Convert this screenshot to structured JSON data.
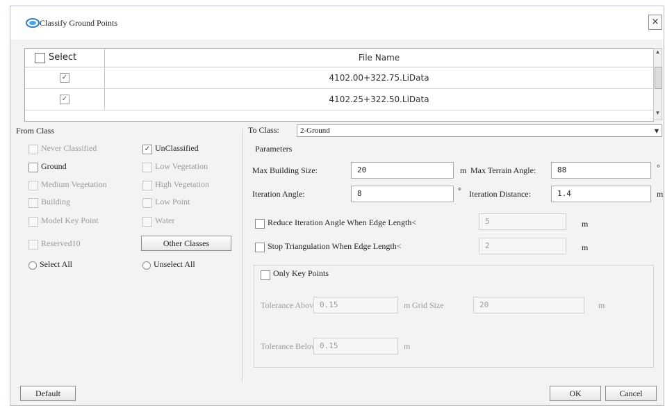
{
  "window": {
    "title": "Classify Ground Points",
    "close_glyph": "×"
  },
  "grid": {
    "select_header": "Select",
    "file_header": "File Name",
    "rows": [
      {
        "checked": "✓",
        "file": "4102.00+322.75.LiData"
      },
      {
        "checked": "✓",
        "file": "4102.25+322.50.LiData"
      }
    ]
  },
  "from_class": {
    "title": "From Class",
    "items": [
      {
        "label": "Never Classified",
        "checked": false,
        "enabled": false
      },
      {
        "label": "UnClassified",
        "checked": true,
        "enabled": true
      },
      {
        "label": "Ground",
        "checked": false,
        "enabled": true
      },
      {
        "label": "Low Vegetation",
        "checked": false,
        "enabled": false
      },
      {
        "label": "Medium Vegetation",
        "checked": false,
        "enabled": false
      },
      {
        "label": "High Vegetation",
        "checked": false,
        "enabled": false
      },
      {
        "label": "Building",
        "checked": false,
        "enabled": false
      },
      {
        "label": "Low Point",
        "checked": false,
        "enabled": false
      },
      {
        "label": "Model Key Point",
        "checked": false,
        "enabled": false
      },
      {
        "label": "Water",
        "checked": false,
        "enabled": false
      },
      {
        "label": "Reserved10",
        "checked": false,
        "enabled": false
      }
    ],
    "other_classes_button": "Other Classes",
    "select_all": "Select All",
    "unselect_all": "Unselect All"
  },
  "to_class": {
    "label": "To Class:",
    "value": "2-Ground"
  },
  "parameters": {
    "title": "Parameters",
    "max_building_size_label": "Max Building Size:",
    "max_building_size": "20",
    "max_building_unit": "m",
    "max_terrain_angle_label": "Max Terrain Angle:",
    "max_terrain_angle": "88",
    "max_terrain_unit": "°",
    "iteration_angle_label": "Iteration Angle:",
    "iteration_angle": "8",
    "iteration_angle_unit": "°",
    "iteration_distance_label": "Iteration Distance:",
    "iteration_distance": "1.4",
    "iteration_distance_unit": "m",
    "reduce_label": "Reduce Iteration Angle When Edge Length<",
    "reduce_value": "5",
    "reduce_unit": "m",
    "stop_label": "Stop Triangulation When Edge Length<",
    "stop_value": "2",
    "stop_unit": "m",
    "only_key_points_label": "Only Key Points",
    "tolerance_above_label": "Tolerance Above",
    "tolerance_above": "0.15",
    "tolerance_above_unit": "m",
    "grid_size_label": "Grid Size",
    "grid_size": "20",
    "grid_size_unit": "m",
    "tolerance_below_label": "Tolerance Below",
    "tolerance_below": "0.15",
    "tolerance_below_unit": "m"
  },
  "buttons": {
    "default": "Default",
    "ok": "OK",
    "cancel": "Cancel"
  }
}
